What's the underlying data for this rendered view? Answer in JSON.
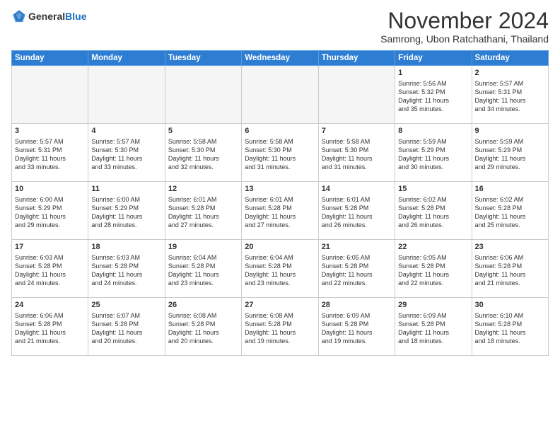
{
  "header": {
    "logo_general": "General",
    "logo_blue": "Blue",
    "month_title": "November 2024",
    "location": "Samrong, Ubon Ratchathani, Thailand"
  },
  "weekdays": [
    "Sunday",
    "Monday",
    "Tuesday",
    "Wednesday",
    "Thursday",
    "Friday",
    "Saturday"
  ],
  "weeks": [
    [
      {
        "day": "",
        "info": ""
      },
      {
        "day": "",
        "info": ""
      },
      {
        "day": "",
        "info": ""
      },
      {
        "day": "",
        "info": ""
      },
      {
        "day": "",
        "info": ""
      },
      {
        "day": "1",
        "info": "Sunrise: 5:56 AM\nSunset: 5:32 PM\nDaylight: 11 hours\nand 35 minutes."
      },
      {
        "day": "2",
        "info": "Sunrise: 5:57 AM\nSunset: 5:31 PM\nDaylight: 11 hours\nand 34 minutes."
      }
    ],
    [
      {
        "day": "3",
        "info": "Sunrise: 5:57 AM\nSunset: 5:31 PM\nDaylight: 11 hours\nand 33 minutes."
      },
      {
        "day": "4",
        "info": "Sunrise: 5:57 AM\nSunset: 5:30 PM\nDaylight: 11 hours\nand 33 minutes."
      },
      {
        "day": "5",
        "info": "Sunrise: 5:58 AM\nSunset: 5:30 PM\nDaylight: 11 hours\nand 32 minutes."
      },
      {
        "day": "6",
        "info": "Sunrise: 5:58 AM\nSunset: 5:30 PM\nDaylight: 11 hours\nand 31 minutes."
      },
      {
        "day": "7",
        "info": "Sunrise: 5:58 AM\nSunset: 5:30 PM\nDaylight: 11 hours\nand 31 minutes."
      },
      {
        "day": "8",
        "info": "Sunrise: 5:59 AM\nSunset: 5:29 PM\nDaylight: 11 hours\nand 30 minutes."
      },
      {
        "day": "9",
        "info": "Sunrise: 5:59 AM\nSunset: 5:29 PM\nDaylight: 11 hours\nand 29 minutes."
      }
    ],
    [
      {
        "day": "10",
        "info": "Sunrise: 6:00 AM\nSunset: 5:29 PM\nDaylight: 11 hours\nand 29 minutes."
      },
      {
        "day": "11",
        "info": "Sunrise: 6:00 AM\nSunset: 5:29 PM\nDaylight: 11 hours\nand 28 minutes."
      },
      {
        "day": "12",
        "info": "Sunrise: 6:01 AM\nSunset: 5:28 PM\nDaylight: 11 hours\nand 27 minutes."
      },
      {
        "day": "13",
        "info": "Sunrise: 6:01 AM\nSunset: 5:28 PM\nDaylight: 11 hours\nand 27 minutes."
      },
      {
        "day": "14",
        "info": "Sunrise: 6:01 AM\nSunset: 5:28 PM\nDaylight: 11 hours\nand 26 minutes."
      },
      {
        "day": "15",
        "info": "Sunrise: 6:02 AM\nSunset: 5:28 PM\nDaylight: 11 hours\nand 26 minutes."
      },
      {
        "day": "16",
        "info": "Sunrise: 6:02 AM\nSunset: 5:28 PM\nDaylight: 11 hours\nand 25 minutes."
      }
    ],
    [
      {
        "day": "17",
        "info": "Sunrise: 6:03 AM\nSunset: 5:28 PM\nDaylight: 11 hours\nand 24 minutes."
      },
      {
        "day": "18",
        "info": "Sunrise: 6:03 AM\nSunset: 5:28 PM\nDaylight: 11 hours\nand 24 minutes."
      },
      {
        "day": "19",
        "info": "Sunrise: 6:04 AM\nSunset: 5:28 PM\nDaylight: 11 hours\nand 23 minutes."
      },
      {
        "day": "20",
        "info": "Sunrise: 6:04 AM\nSunset: 5:28 PM\nDaylight: 11 hours\nand 23 minutes."
      },
      {
        "day": "21",
        "info": "Sunrise: 6:05 AM\nSunset: 5:28 PM\nDaylight: 11 hours\nand 22 minutes."
      },
      {
        "day": "22",
        "info": "Sunrise: 6:05 AM\nSunset: 5:28 PM\nDaylight: 11 hours\nand 22 minutes."
      },
      {
        "day": "23",
        "info": "Sunrise: 6:06 AM\nSunset: 5:28 PM\nDaylight: 11 hours\nand 21 minutes."
      }
    ],
    [
      {
        "day": "24",
        "info": "Sunrise: 6:06 AM\nSunset: 5:28 PM\nDaylight: 11 hours\nand 21 minutes."
      },
      {
        "day": "25",
        "info": "Sunrise: 6:07 AM\nSunset: 5:28 PM\nDaylight: 11 hours\nand 20 minutes."
      },
      {
        "day": "26",
        "info": "Sunrise: 6:08 AM\nSunset: 5:28 PM\nDaylight: 11 hours\nand 20 minutes."
      },
      {
        "day": "27",
        "info": "Sunrise: 6:08 AM\nSunset: 5:28 PM\nDaylight: 11 hours\nand 19 minutes."
      },
      {
        "day": "28",
        "info": "Sunrise: 6:09 AM\nSunset: 5:28 PM\nDaylight: 11 hours\nand 19 minutes."
      },
      {
        "day": "29",
        "info": "Sunrise: 6:09 AM\nSunset: 5:28 PM\nDaylight: 11 hours\nand 18 minutes."
      },
      {
        "day": "30",
        "info": "Sunrise: 6:10 AM\nSunset: 5:28 PM\nDaylight: 11 hours\nand 18 minutes."
      }
    ]
  ]
}
